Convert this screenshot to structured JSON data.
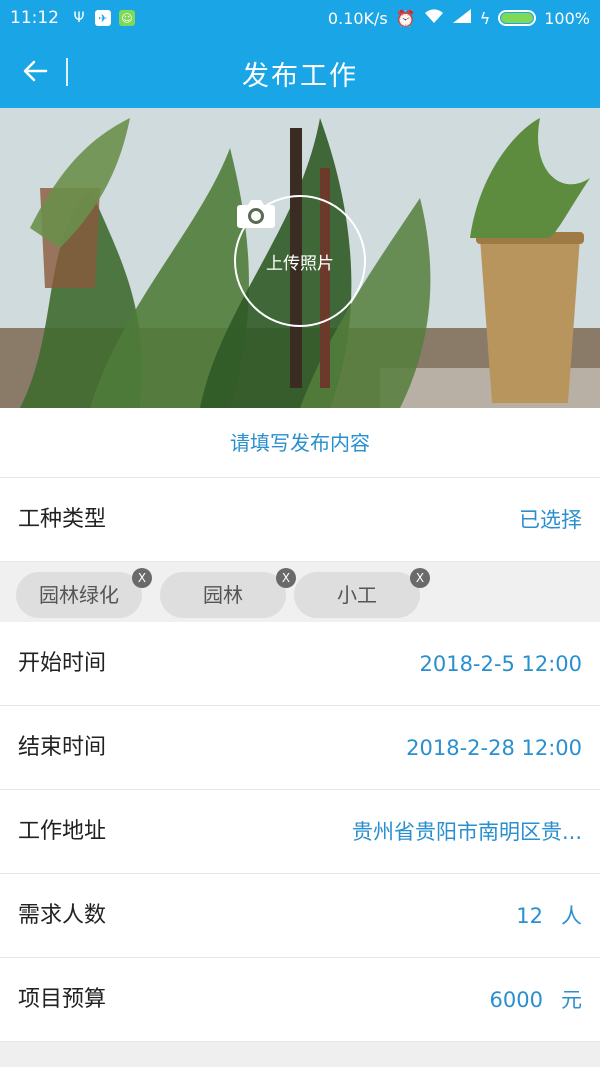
{
  "status_bar": {
    "time": "11:12",
    "network_speed": "0.10K/s",
    "battery": "100%",
    "icons": [
      "usb-icon",
      "bird-app-icon",
      "android-app-icon",
      "alarm-icon",
      "wifi-icon",
      "signal-icon",
      "charging-icon",
      "battery-icon"
    ]
  },
  "header": {
    "title": "发布工作",
    "back_icon": "arrow-left-icon"
  },
  "photo": {
    "upload_label": "上传照片",
    "upload_icon": "camera-icon"
  },
  "form": {
    "hint": "请填写发布内容",
    "job_type": {
      "label": "工种类型",
      "value": "已选择"
    },
    "tags": [
      {
        "label": "园林绿化",
        "remove": "X"
      },
      {
        "label": "园林",
        "remove": "X"
      },
      {
        "label": "小工",
        "remove": "X"
      }
    ],
    "start_time": {
      "label": "开始时间",
      "value": "2018-2-5 12:00"
    },
    "end_time": {
      "label": "结束时间",
      "value": "2018-2-28 12:00"
    },
    "address": {
      "label": "工作地址",
      "value": "贵州省贵阳市南明区贵..."
    },
    "headcount": {
      "label": "需求人数",
      "value": "12",
      "unit": "人"
    },
    "budget": {
      "label": "项目预算",
      "value": "6000",
      "unit": "元"
    }
  },
  "colors": {
    "primary": "#1aa6e6",
    "link": "#2a8fcf",
    "tag_bg": "#dedede"
  }
}
